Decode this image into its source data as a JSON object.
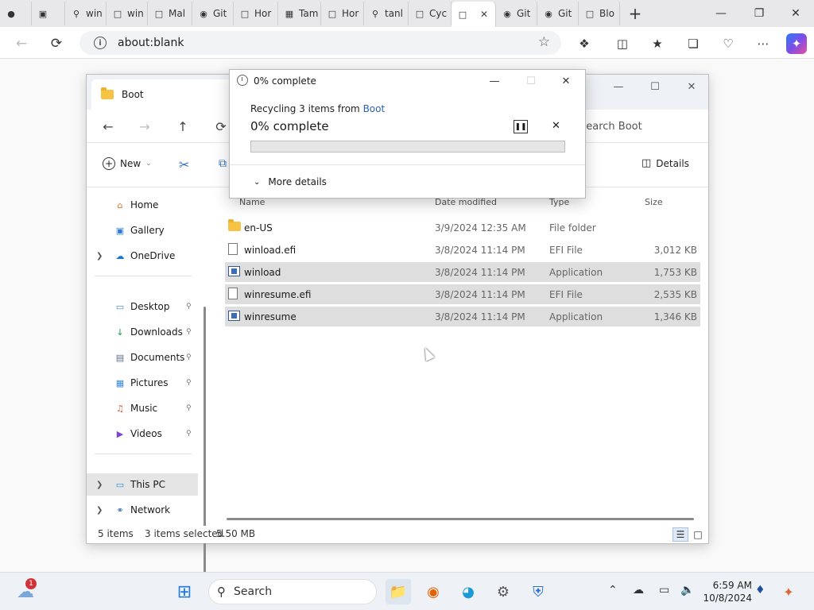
{
  "browser": {
    "tabs": [
      {
        "label": "",
        "icon": "profile-icon"
      },
      {
        "label": "",
        "icon": "tab-actions-icon"
      },
      {
        "label": "win",
        "icon": "search-icon"
      },
      {
        "label": "win",
        "icon": "page-icon"
      },
      {
        "label": "Mal",
        "icon": "page-icon"
      },
      {
        "label": "Git",
        "icon": "github-icon"
      },
      {
        "label": "Hor",
        "icon": "page-icon"
      },
      {
        "label": "Tam",
        "icon": "microsoft-icon"
      },
      {
        "label": "Hor",
        "icon": "page-icon"
      },
      {
        "label": "tanl",
        "icon": "search-icon"
      },
      {
        "label": "Cyc",
        "icon": "page-icon"
      },
      {
        "label": "",
        "icon": "page-icon",
        "active": true
      },
      {
        "label": "Git",
        "icon": "github-icon"
      },
      {
        "label": "Git",
        "icon": "github-icon"
      },
      {
        "label": "Blo",
        "icon": "page-icon"
      }
    ],
    "address": "about:blank"
  },
  "explorer": {
    "tab_title": "Boot",
    "search_placeholder": "Search Boot",
    "toolbar": {
      "new_label": "New",
      "details_label": "Details"
    },
    "sidebar": {
      "items": [
        {
          "label": "Home",
          "icon": "home-icon",
          "chev": false,
          "pin": false
        },
        {
          "label": "Gallery",
          "icon": "gallery-icon",
          "chev": false,
          "pin": false
        },
        {
          "label": "OneDrive",
          "icon": "cloud-icon",
          "chev": true,
          "pin": false
        },
        {
          "label": "Desktop",
          "icon": "desktop-icon",
          "chev": false,
          "pin": true
        },
        {
          "label": "Downloads",
          "icon": "download-icon",
          "chev": false,
          "pin": true
        },
        {
          "label": "Documents",
          "icon": "documents-icon",
          "chev": false,
          "pin": true
        },
        {
          "label": "Pictures",
          "icon": "pictures-icon",
          "chev": false,
          "pin": true
        },
        {
          "label": "Music",
          "icon": "music-icon",
          "chev": false,
          "pin": true
        },
        {
          "label": "Videos",
          "icon": "videos-icon",
          "chev": false,
          "pin": true
        },
        {
          "label": "This PC",
          "icon": "pc-icon",
          "chev": true,
          "pin": false,
          "selected": true
        },
        {
          "label": "Network",
          "icon": "network-icon",
          "chev": true,
          "pin": false
        }
      ]
    },
    "columns": {
      "name": "Name",
      "date": "Date modified",
      "type": "Type",
      "size": "Size"
    },
    "files": [
      {
        "name": "en-US",
        "date": "3/9/2024 12:35 AM",
        "type": "File folder",
        "size": "",
        "kind": "folder",
        "selected": false
      },
      {
        "name": "winload.efi",
        "date": "3/8/2024 11:14 PM",
        "type": "EFI File",
        "size": "3,012 KB",
        "kind": "file",
        "selected": false
      },
      {
        "name": "winload",
        "date": "3/8/2024 11:14 PM",
        "type": "Application",
        "size": "1,753 KB",
        "kind": "app",
        "selected": true
      },
      {
        "name": "winresume.efi",
        "date": "3/8/2024 11:14 PM",
        "type": "EFI File",
        "size": "2,535 KB",
        "kind": "file",
        "selected": true
      },
      {
        "name": "winresume",
        "date": "3/8/2024 11:14 PM",
        "type": "Application",
        "size": "1,346 KB",
        "kind": "app",
        "selected": true
      }
    ],
    "status": {
      "items": "5 items",
      "selected": "3 items selected",
      "size": "5.50 MB"
    }
  },
  "dialog": {
    "title": "0% complete",
    "subtitle_prefix": "Recycling 3 items from ",
    "subtitle_link": "Boot",
    "percent_text": "0% complete",
    "progress": 0,
    "more_details": "More details"
  },
  "taskbar": {
    "search_label": "Search",
    "weather_badge": "1",
    "time": "6:59 AM",
    "date": "10/8/2024"
  }
}
